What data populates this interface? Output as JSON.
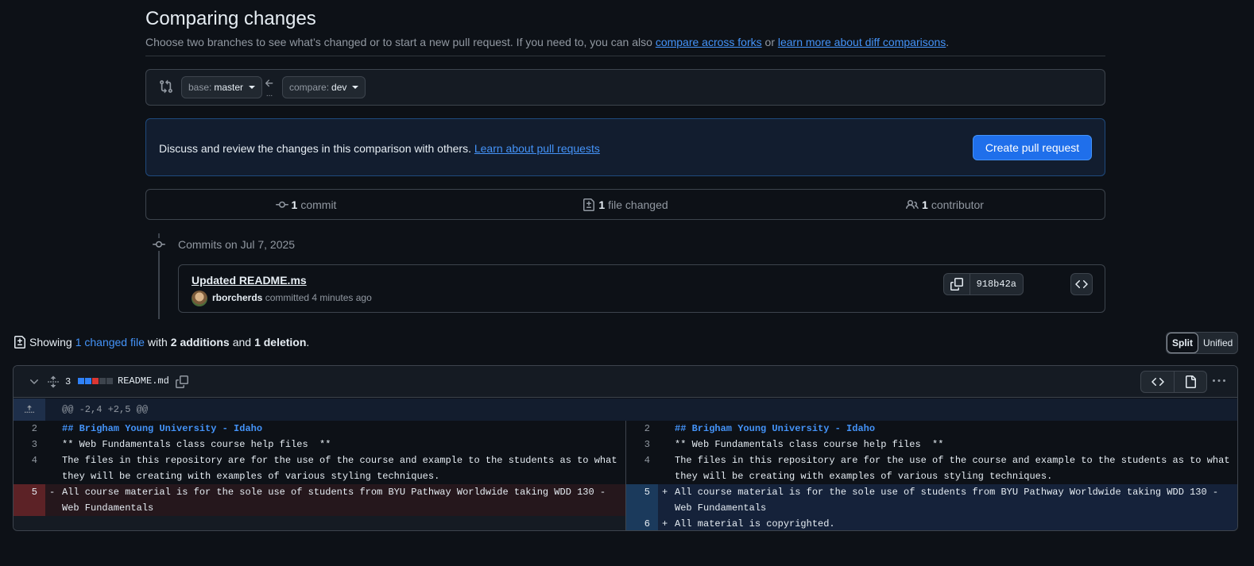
{
  "header": {
    "title": "Comparing changes",
    "subtitle_prefix": "Choose two branches to see what’s changed or to start a new pull request. If you need to, you can also",
    "compare_forks_link": "compare across forks",
    "or_text": "or",
    "learn_diff_link": "learn more about diff comparisons",
    "period": "."
  },
  "range": {
    "base_label": "base:",
    "base_branch": "master",
    "compare_label": "compare:",
    "compare_branch": "dev",
    "dots": "..."
  },
  "flash": {
    "text": "Discuss and review the changes in this comparison with others.",
    "link": "Learn about pull requests",
    "button": "Create pull request"
  },
  "stats": {
    "commits_count": "1",
    "commits_label": "commit",
    "files_count": "1",
    "files_label": "file changed",
    "contributors_count": "1",
    "contributors_label": "contributor"
  },
  "commits": {
    "date_heading": "Commits on Jul 7, 2025",
    "items": [
      {
        "title": "Updated README.ms",
        "author": "rborcherds",
        "action": "committed 4 minutes ago",
        "sha": "918b42a"
      }
    ]
  },
  "summary": {
    "showing": "Showing",
    "changed_link": "1 changed file",
    "with": "with",
    "additions": "2 additions",
    "and": "and",
    "deletions": "1 deletion",
    "period": "."
  },
  "view_toggle": {
    "split": "Split",
    "unified": "Unified",
    "active": "Split"
  },
  "file": {
    "change_count": "3",
    "name": "README.md",
    "hunk_header": "@@ -2,4 +2,5 @@",
    "diffstat": [
      "added",
      "added",
      "deleted",
      "neutral",
      "neutral"
    ],
    "left": [
      {
        "num": "2",
        "marker": "",
        "type": "context",
        "code": "## Brigham Young University - Idaho",
        "heading": true
      },
      {
        "num": "3",
        "marker": "",
        "type": "context",
        "code": "** Web Fundamentals class course help files  **"
      },
      {
        "num": "4",
        "marker": "",
        "type": "context",
        "code": "The files in this repository are for the use of the course and example to the students as to what they will be creating with examples of various styling techniques."
      },
      {
        "num": "5",
        "marker": "-",
        "type": "del",
        "code": "All course material is for the sole use of students from BYU Pathway Worldwide taking WDD 130 - Web Fundamentals"
      }
    ],
    "right": [
      {
        "num": "2",
        "marker": "",
        "type": "context",
        "code": "## Brigham Young University - Idaho",
        "heading": true
      },
      {
        "num": "3",
        "marker": "",
        "type": "context",
        "code": "** Web Fundamentals class course help files  **"
      },
      {
        "num": "4",
        "marker": "",
        "type": "context",
        "code": "The files in this repository are for the use of the course and example to the students as to what they will be creating with examples of various styling techniques."
      },
      {
        "num": "5",
        "marker": "+",
        "type": "add",
        "code": "All course material is for the sole use of students from BYU Pathway Worldwide taking WDD 130 - Web Fundamentals"
      },
      {
        "num": "6",
        "marker": "+",
        "type": "add",
        "code": "All material is copyrighted."
      }
    ]
  },
  "colors": {
    "accent": "#1f6feb",
    "link": "#4493f8",
    "addition": "#2f81f7",
    "deletion": "#da3633",
    "background": "#0d1117"
  }
}
